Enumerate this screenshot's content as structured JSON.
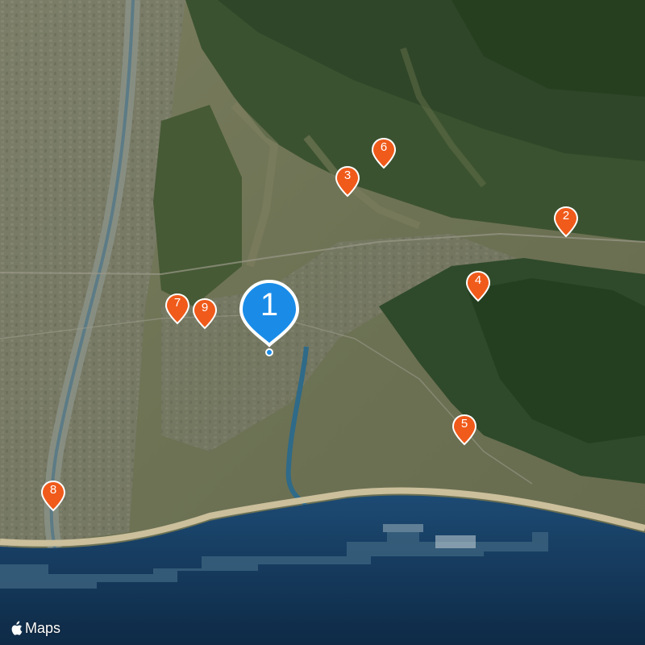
{
  "map": {
    "type": "satellite",
    "brand": "Maps",
    "colors": {
      "pin": "#f05a1a",
      "pin_selected": "#1a8ce8",
      "sea": "#123456",
      "land": "#6f7752",
      "forest": "#2f4a2a"
    },
    "selected_marker": {
      "label": "1"
    },
    "markers": [
      {
        "label": "2"
      },
      {
        "label": "3"
      },
      {
        "label": "4"
      },
      {
        "label": "5"
      },
      {
        "label": "6"
      },
      {
        "label": "7"
      },
      {
        "label": "8"
      },
      {
        "label": "9"
      }
    ]
  }
}
